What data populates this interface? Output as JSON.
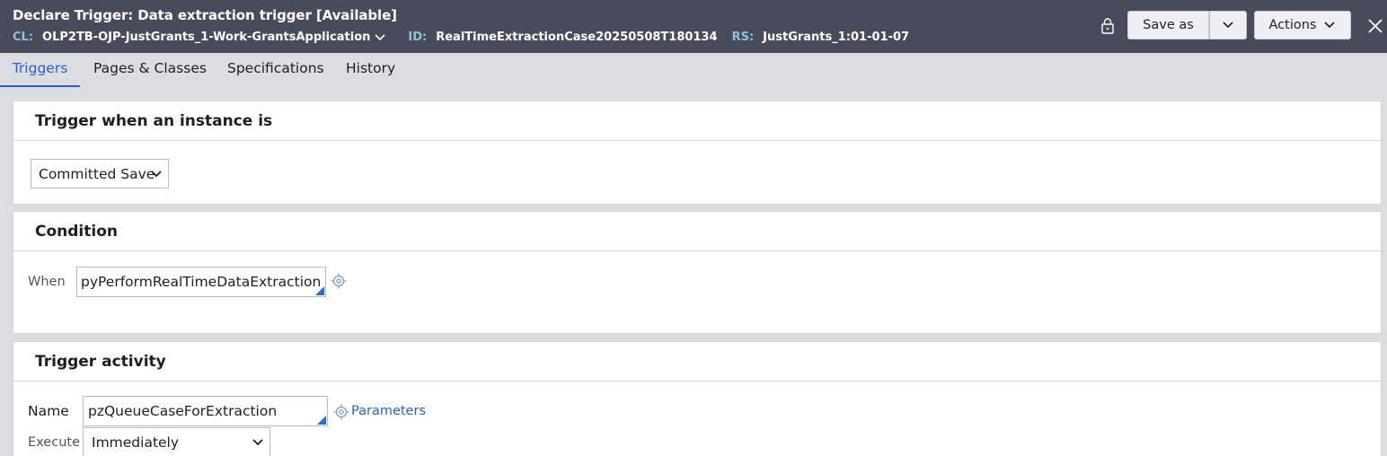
{
  "header": {
    "title": "Declare Trigger: Data extraction trigger [Available]",
    "cl_label": "CL:",
    "cl_value": "OLP2TB-OJP-JustGrants_1-Work-GrantsApplication",
    "id_label": "ID:",
    "id_value": "RealTimeExtractionCase20250508T180134",
    "rs_label": "RS:",
    "rs_value": "JustGrants_1:01-01-07",
    "save_as_label": "Save as",
    "actions_label": "Actions"
  },
  "tabs": [
    {
      "label": "Triggers",
      "active": true
    },
    {
      "label": "Pages & Classes",
      "active": false
    },
    {
      "label": "Specifications",
      "active": false
    },
    {
      "label": "History",
      "active": false
    }
  ],
  "trigger_when": {
    "heading": "Trigger when an instance is",
    "selected": "Committed Save"
  },
  "condition": {
    "heading": "Condition",
    "when_label": "When",
    "when_value": "pyPerformRealTimeDataExtraction"
  },
  "trigger_activity": {
    "heading": "Trigger activity",
    "name_label": "Name",
    "name_value": "pzQueueCaseForExtraction",
    "parameters_label": "Parameters",
    "execute_label": "Execute",
    "execute_value": "Immediately"
  },
  "colors": {
    "header_bg": "#474b5c",
    "accent": "#2a5fd0",
    "meta_label": "#8fc3dc"
  }
}
